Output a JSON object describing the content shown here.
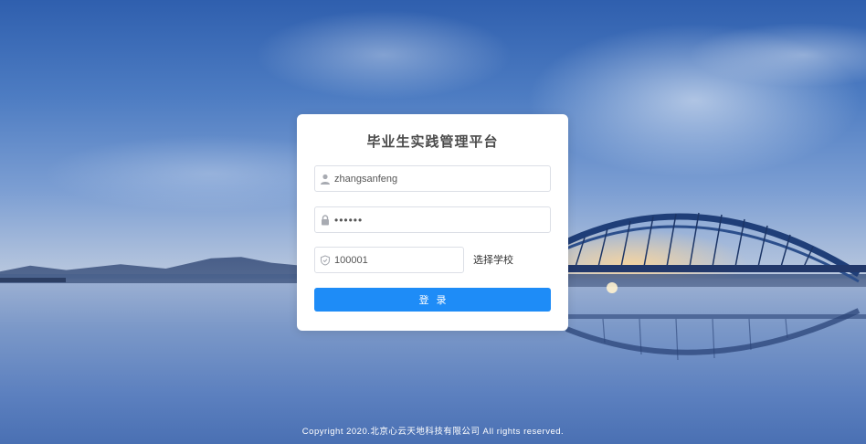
{
  "login": {
    "title": "毕业生实践管理平台",
    "username": {
      "value": "zhangsanfeng",
      "icon": "user-icon"
    },
    "password": {
      "value": "••••••",
      "icon": "lock-icon"
    },
    "school_code": {
      "value": "100001",
      "icon": "shield-icon"
    },
    "select_school_label": "选择学校",
    "submit_label": "登录"
  },
  "footer": {
    "copyright": "Copyright 2020.北京心云天地科技有限公司 All rights reserved."
  },
  "colors": {
    "primary": "#1e8cf7",
    "card_bg": "#ffffff",
    "field_border": "#dcdfe6",
    "icon_gray": "#a8abb2"
  }
}
